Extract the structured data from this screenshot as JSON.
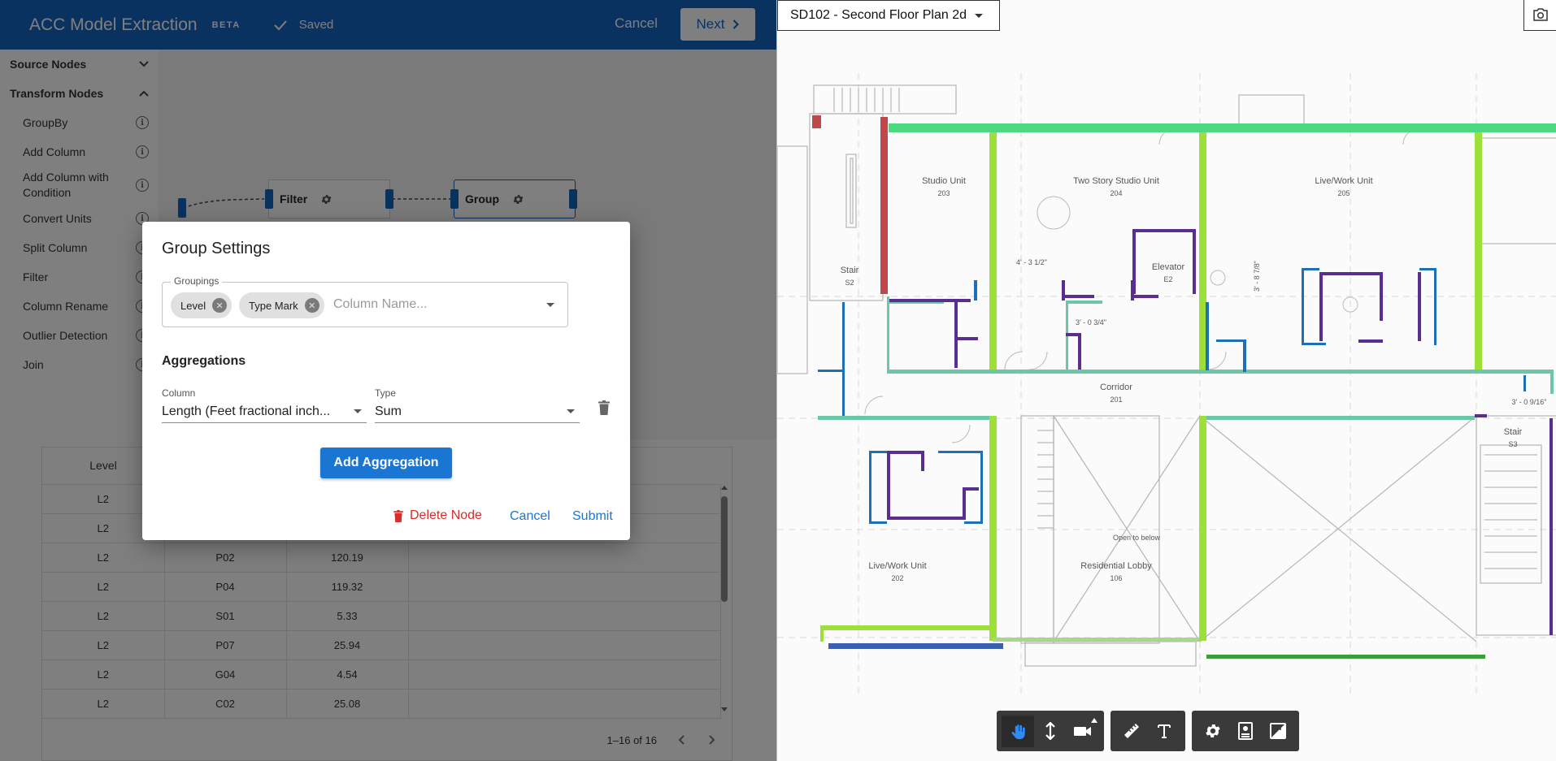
{
  "app": {
    "title": "ACC Model Extraction",
    "badge": "BETA",
    "saved": "Saved",
    "cancel": "Cancel",
    "next": "Next"
  },
  "sidebar": {
    "source_nodes": "Source Nodes",
    "transform_nodes": "Transform Nodes",
    "items": [
      "GroupBy",
      "Add Column",
      "Add Column with Condition",
      "Convert Units",
      "Split Column",
      "Filter",
      "Column Rename",
      "Outlier Detection",
      "Join"
    ]
  },
  "canvas": {
    "filter_node": "Filter",
    "group_node": "Group"
  },
  "table": {
    "header_level": "Level",
    "rows": [
      {
        "level": "L2",
        "mark": "",
        "value": ""
      },
      {
        "level": "L2",
        "mark": "",
        "value": ""
      },
      {
        "level": "L2",
        "mark": "P02",
        "value": "120.19"
      },
      {
        "level": "L2",
        "mark": "P04",
        "value": "119.32"
      },
      {
        "level": "L2",
        "mark": "S01",
        "value": "5.33"
      },
      {
        "level": "L2",
        "mark": "P07",
        "value": "25.94"
      },
      {
        "level": "L2",
        "mark": "G04",
        "value": "4.54"
      },
      {
        "level": "L2",
        "mark": "C02",
        "value": "25.08"
      }
    ],
    "pagination": "1–16 of 16"
  },
  "dialog": {
    "title": "Group Settings",
    "groupings_label": "Groupings",
    "chips": [
      "Level",
      "Type Mark"
    ],
    "column_placeholder": "Column Name...",
    "aggregations_title": "Aggregations",
    "column_label": "Column",
    "column_value": "Length (Feet fractional inch...",
    "type_label": "Type",
    "type_value": "Sum",
    "add_aggregation": "Add Aggregation",
    "delete_node": "Delete Node",
    "cancel": "Cancel",
    "submit": "Submit"
  },
  "viewer": {
    "sheet": "SD102 - Second Floor Plan 2d",
    "rooms": [
      {
        "name": "Studio Unit",
        "num": "203"
      },
      {
        "name": "Two Story Studio Unit",
        "num": "204"
      },
      {
        "name": "Live/Work Unit",
        "num": "205"
      },
      {
        "name": "Stair",
        "num": "S2"
      },
      {
        "name": "Elevator",
        "num": "E2"
      },
      {
        "name": "Corridor",
        "num": "201"
      },
      {
        "name": "Stair",
        "num": "S3"
      },
      {
        "name": "Live/Work Unit",
        "num": "202"
      },
      {
        "name": "Residential Lobby",
        "num": "106"
      }
    ],
    "open_to_below": "Open to below",
    "dims": [
      "4' - 3 1/2\"",
      "3' - 0 3/4\"",
      "3' - 8 7/8\"",
      "3' - 0 9/16\""
    ],
    "toolbar_icons": [
      "pan-icon",
      "zoom-icon",
      "camera-icon",
      "measure-icon",
      "text-icon",
      "settings-icon",
      "properties-icon",
      "fullscreen-icon"
    ]
  },
  "colors": {
    "topbar": "#1565c0",
    "wall_green": "#9ee03a",
    "wall_blue": "#1f6fb8",
    "wall_purple": "#5a2d91",
    "wall_teal": "#6cc7a8",
    "wall_red": "#c0474a",
    "danger": "#d32f2f"
  }
}
